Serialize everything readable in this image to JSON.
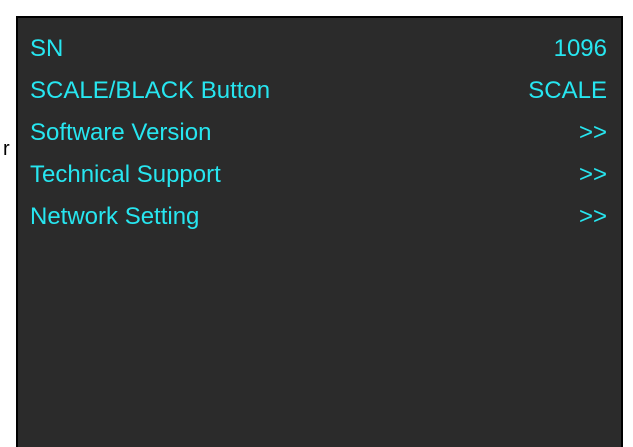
{
  "colors": {
    "screen_background": "#2b2b2b",
    "text": "#27e6f0",
    "border": "#000000",
    "page_background": "#ffffff"
  },
  "stray_glyph": "r",
  "menu": {
    "items": [
      {
        "label": "SN",
        "value": "1096"
      },
      {
        "label": "SCALE/BLACK Button",
        "value": "SCALE"
      },
      {
        "label": "Software Version",
        "value": ">>"
      },
      {
        "label": "Technical Support",
        "value": ">>"
      },
      {
        "label": "Network Setting",
        "value": ">>"
      }
    ]
  }
}
